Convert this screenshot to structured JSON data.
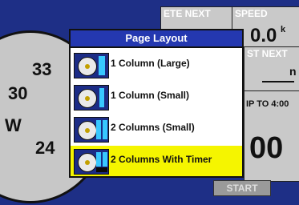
{
  "background": {
    "compass": {
      "labels": [
        "33",
        "30",
        "W",
        "24"
      ]
    },
    "panels": {
      "ete_label": "ETE NEXT",
      "speed_label": "SPEED",
      "speed_value": "0.0",
      "speed_unit": "k",
      "dist_label": "ST NEXT",
      "dist_unit": "n",
      "trip_label": "IP TO 4:00",
      "big_value": "00",
      "start_button": "START"
    }
  },
  "dialog": {
    "title": "Page Layout",
    "options": [
      {
        "label": "1 Column (Large)",
        "selected": false
      },
      {
        "label": "1 Column (Small)",
        "selected": false
      },
      {
        "label": "2 Columns (Small)",
        "selected": false
      },
      {
        "label": "2 Columns With Timer",
        "selected": true
      }
    ]
  },
  "colors": {
    "screen_bg": "#1e2f86",
    "title_bar": "#2438b0",
    "selection": "#f5f500",
    "thumb_column": "#38c8ff"
  }
}
